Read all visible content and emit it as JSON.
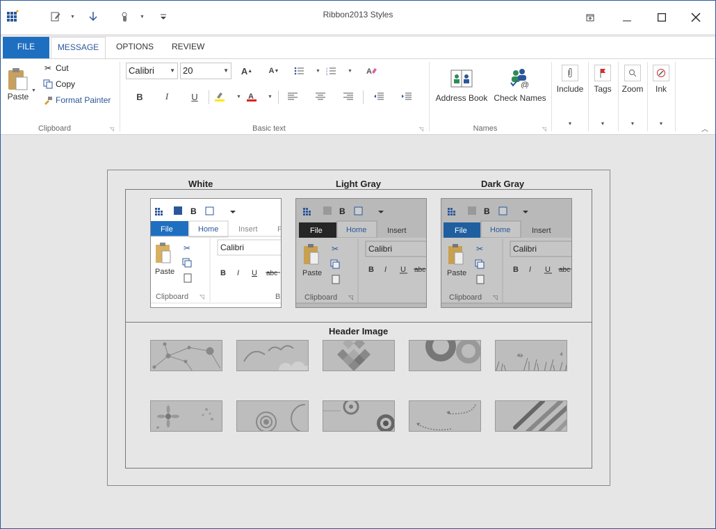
{
  "window": {
    "title": "Ribbon2013 Styles",
    "controls": [
      "restore-icon",
      "minimize-icon",
      "maximize-icon",
      "close-icon"
    ]
  },
  "tabs": [
    {
      "label": "FILE"
    },
    {
      "label": "MESSAGE"
    },
    {
      "label": "OPTIONS"
    },
    {
      "label": "REVIEW"
    }
  ],
  "clipboard": {
    "paste": "Paste",
    "cut": "Cut",
    "copy": "Copy",
    "format_painter": "Format Painter",
    "group": "Clipboard"
  },
  "basic_text": {
    "font": "Calibri",
    "size": "20",
    "group": "Basic text"
  },
  "names": {
    "address_book": "Address Book",
    "check_names": "Check Names",
    "group": "Names"
  },
  "collapsed": {
    "include": "Include",
    "tags": "Tags",
    "zoom": "Zoom",
    "ink": "Ink"
  },
  "styles": {
    "white": "White",
    "light_gray": "Light Gray",
    "dark_gray": "Dark Gray",
    "header_image": "Header Image"
  },
  "preview": {
    "file": "File",
    "home": "Home",
    "insert": "Insert",
    "font": "Calibri",
    "paste": "Paste",
    "clipboard": "Clipboard",
    "strike": "abc",
    "cut_r": "B",
    "extra_tab_white": "P"
  },
  "colors": {
    "accent": "#2b579a",
    "file_tab": "#1f6fc1",
    "light_gray_bg": "#b9b9b9",
    "dark_gray_file": "#262626"
  }
}
